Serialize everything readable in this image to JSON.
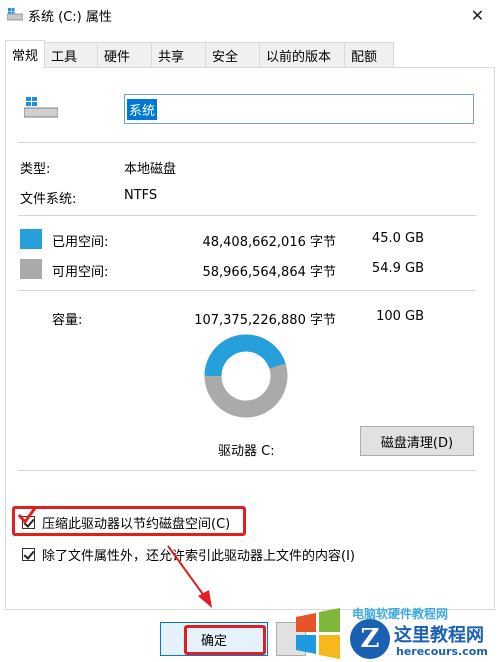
{
  "window": {
    "title": "系统 (C:) 属性",
    "close_glyph": "✕"
  },
  "tabs": [
    "常规",
    "工具",
    "硬件",
    "共享",
    "安全",
    "以前的版本",
    "配额"
  ],
  "active_tab": "常规",
  "drive_name_value": "系统",
  "type": {
    "label": "类型:",
    "value": "本地磁盘"
  },
  "filesystem": {
    "label": "文件系统:",
    "value": "NTFS"
  },
  "used": {
    "label": "已用空间:",
    "bytes": "48,408,662,016 字节",
    "size": "45.0 GB",
    "color": "#26a0da"
  },
  "free": {
    "label": "可用空间:",
    "bytes": "58,966,564,864 字节",
    "size": "54.9 GB",
    "color": "#aaaaaa"
  },
  "capacity": {
    "label": "容量:",
    "bytes": "107,375,226,880 字节",
    "size": "100 GB"
  },
  "donut": {
    "used_fraction": 0.45,
    "used_color": "#26a0da",
    "free_color": "#aaaaaa"
  },
  "drive_label": "驱动器 C:",
  "cleanup_button": "磁盘清理(D)",
  "options": {
    "compress": {
      "label": "压缩此驱动器以节约磁盘空间(C)",
      "checked": true
    },
    "index": {
      "label": "除了文件属性外，还允许索引此驱动器上文件的内容(I)",
      "checked": true
    }
  },
  "buttons": {
    "ok": "确定"
  },
  "annotation_color": "#e02020",
  "watermark": {
    "top_text": "电脑软硬件教程网",
    "logo_letter": "Z",
    "name": "这里教程网",
    "url": "herecours.com"
  }
}
